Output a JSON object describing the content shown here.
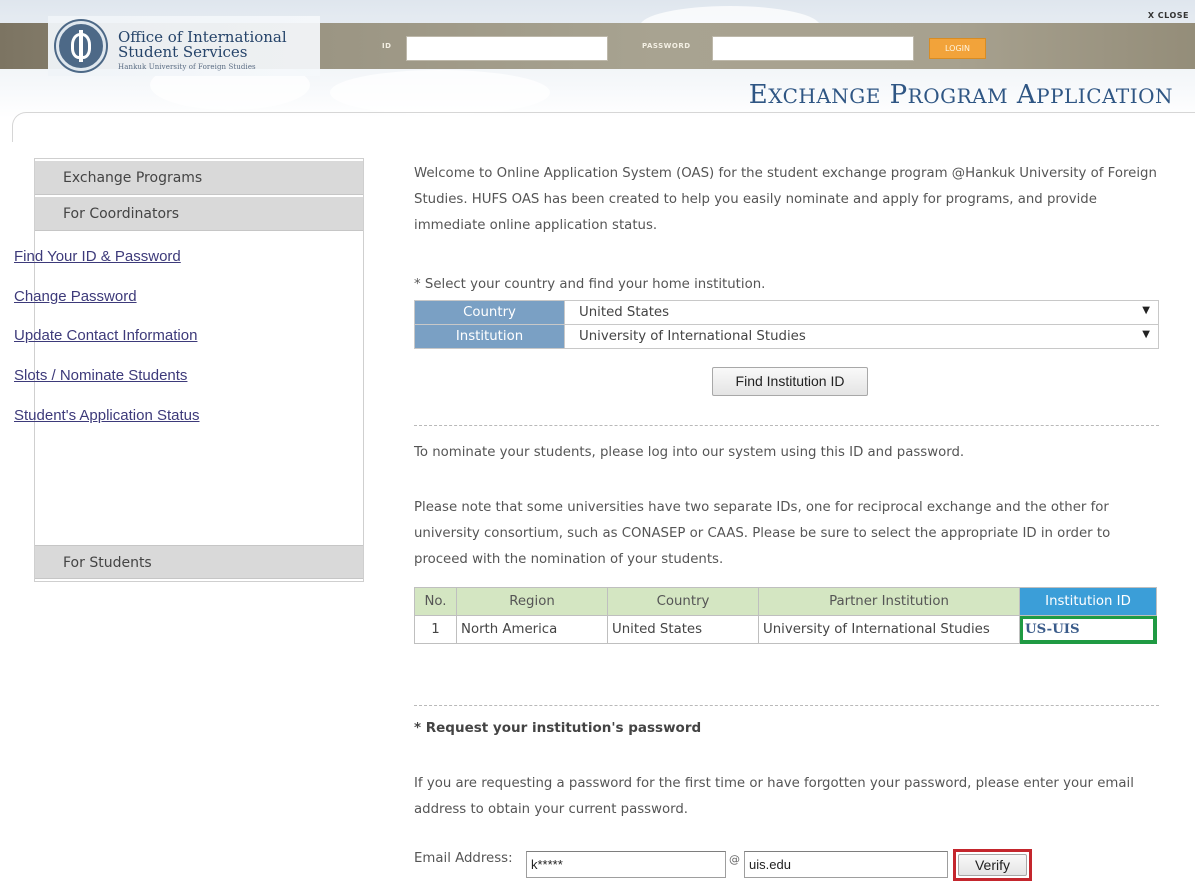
{
  "header": {
    "org_line1": "Office of International",
    "org_line2": "Student Services",
    "org_sub": "Hankuk University of Foreign Studies",
    "id_label": "ID",
    "password_label": "PASSWORD",
    "login_label": "LOGIN",
    "close_label": "X CLOSE",
    "app_title_words": [
      "Exchange",
      "Program",
      "Application"
    ]
  },
  "sidebar": {
    "menu_exchange": "Exchange Programs",
    "menu_coordinators": "For Coordinators",
    "links": [
      "Find Your ID & Password",
      "Change Password",
      "Update Contact Information",
      "Slots / Nominate Students",
      "Student's Application Status"
    ],
    "menu_students": "For Students"
  },
  "main": {
    "welcome": "Welcome to Online Application System (OAS) for the student exchange program @Hankuk University of Foreign Studies. HUFS OAS has been created to help you easily nominate and apply for programs, and provide immediate online application status.",
    "select_prompt": "* Select your country and find your home institution.",
    "country_label": "Country",
    "country_value": "United States",
    "institution_label": "Institution",
    "institution_value": "University of International Studies",
    "find_button": "Find Institution ID",
    "login_note": "To nominate your students, please log into our system using this ID and password.",
    "ids_note": "Please note that some universities have two separate IDs, one for reciprocal exchange and the other for university consortium, such as CONASEP or CAAS. Please be sure to select the appropriate ID in order to proceed with the nomination of your students.",
    "table": {
      "headers": [
        "No.",
        "Region",
        "Country",
        "Partner Institution",
        "Institution ID"
      ],
      "rows": [
        [
          "1",
          "North America",
          "United States",
          "University of International Studies",
          "US-UIS"
        ]
      ]
    },
    "request_title": "* Request your institution's password",
    "request_note": "If you are requesting a password for the first time or have forgotten your password, please enter your email address to obtain your current password.",
    "email_label": "Email Address:",
    "email_user": "k*****",
    "at_symbol": "@",
    "email_domain": "uis.edu",
    "verify_button": "Verify"
  },
  "colors": {
    "label_blue": "#7aa0c4",
    "table_header_green": "#d4e6c2",
    "id_header_blue": "#3b9ed8",
    "id_highlight_green": "#1f9a43",
    "verify_highlight_red": "#c4262d",
    "title_blue": "#2f5684"
  }
}
